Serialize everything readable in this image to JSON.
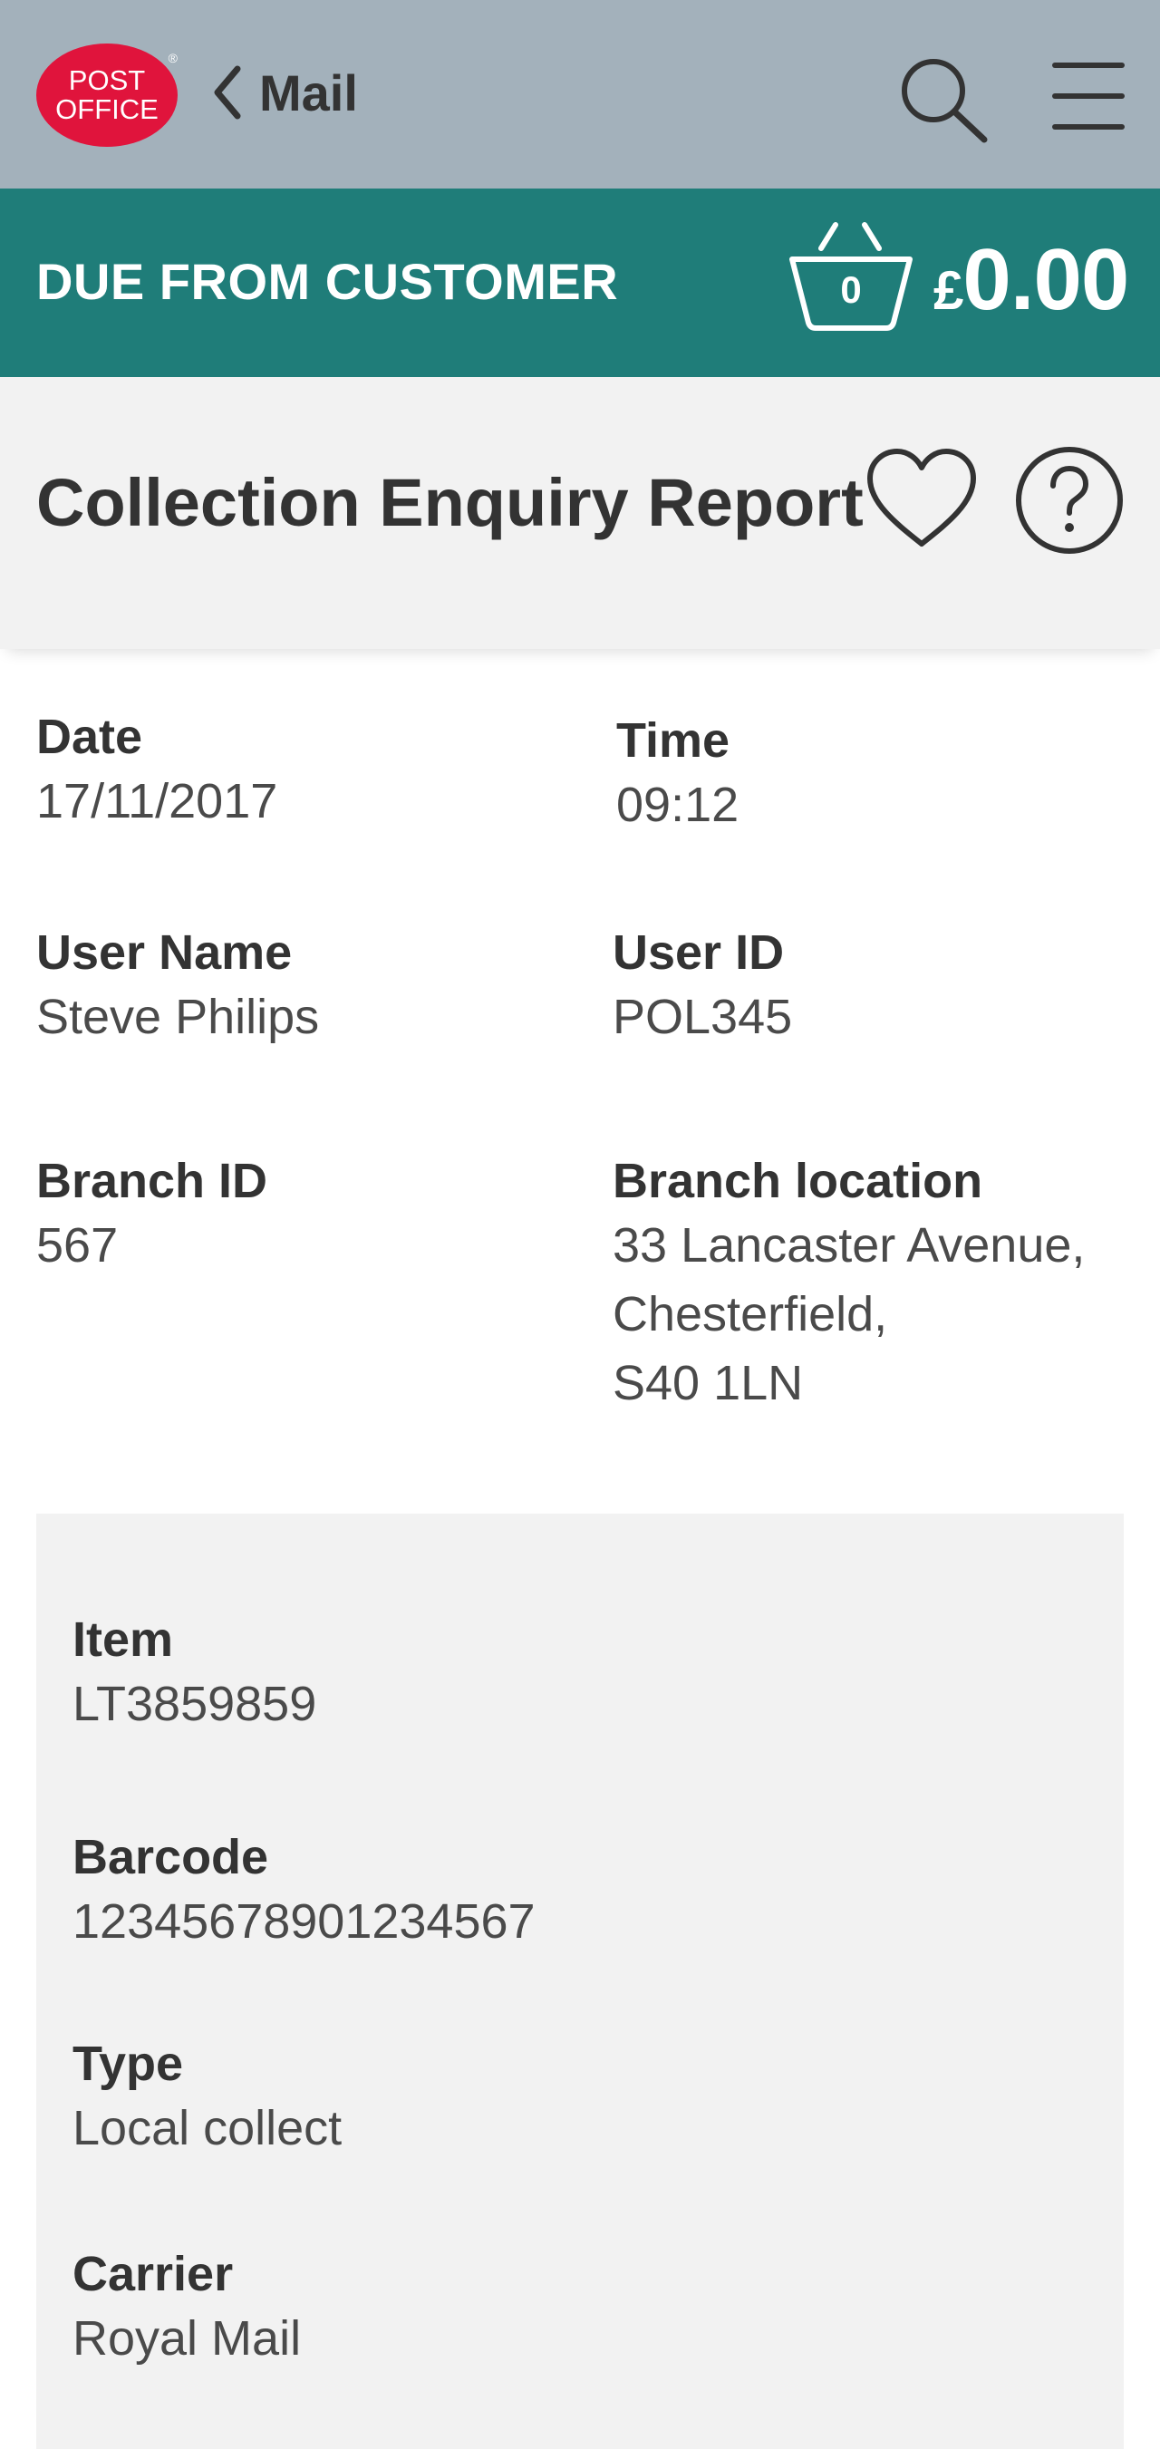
{
  "header": {
    "logo_line1": "POST",
    "logo_line2": "OFFICE",
    "logo_reg": "®",
    "back_label": "Mail",
    "search_icon": "search-icon",
    "menu_icon": "hamburger-menu-icon"
  },
  "due": {
    "label": "DUE FROM CUSTOMER",
    "basket_count": "0",
    "currency": "£",
    "amount": "0.00"
  },
  "page": {
    "title": "Collection Enquiry Report"
  },
  "details": {
    "date_label": "Date",
    "date_value": "17/11/2017",
    "time_label": "Time",
    "time_value": "09:12",
    "user_name_label": "User Name",
    "user_name_value": "Steve Philips",
    "user_id_label": "User ID",
    "user_id_value": "POL345",
    "branch_id_label": "Branch ID",
    "branch_id_value": "567",
    "branch_location_label": "Branch location",
    "branch_location_value": "33 Lancaster Avenue,\nChesterfield,\nS40 1LN"
  },
  "item": {
    "item_label": "Item",
    "item_value": "LT3859859",
    "barcode_label": "Barcode",
    "barcode_value": "12345678901234567",
    "type_label": "Type",
    "type_value": "Local collect",
    "carrier_label": "Carrier",
    "carrier_value": "Royal Mail"
  },
  "colors": {
    "header_bg": "#a3b1bb",
    "due_bar_bg": "#1f7d79",
    "brand_red": "#e0143c",
    "title_bar_bg": "#f2f2f2",
    "card_bg": "#f2f2f2"
  }
}
